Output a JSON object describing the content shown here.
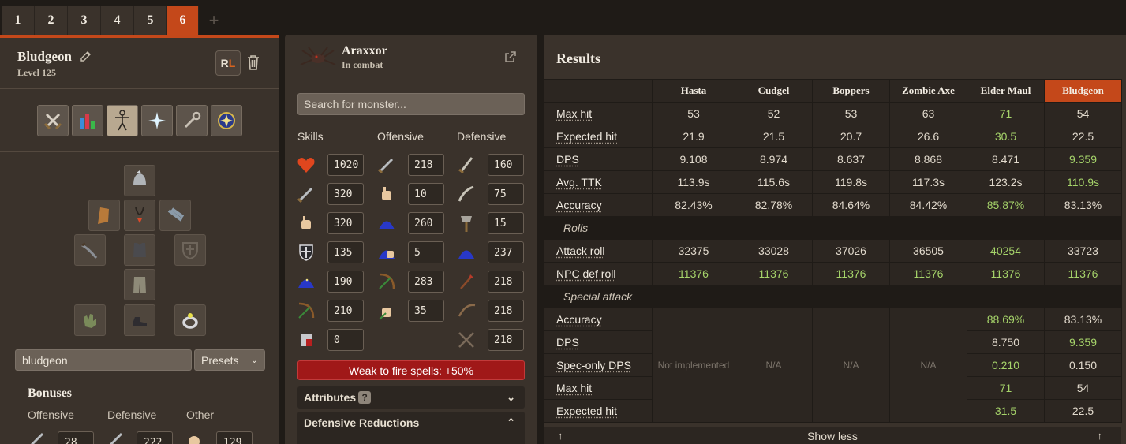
{
  "tabs": [
    "1",
    "2",
    "3",
    "4",
    "5",
    "6"
  ],
  "active_tab": "6",
  "loadout": {
    "name": "Bludgeon",
    "level": "Level 125",
    "rl_label_r": "R",
    "rl_label_l": "L",
    "search_value": "bludgeon",
    "presets_label": "Presets"
  },
  "bonuses": {
    "title": "Bonuses",
    "offensive_label": "Offensive",
    "defensive_label": "Defensive",
    "other_label": "Other",
    "values": [
      "28",
      "222",
      "129"
    ]
  },
  "monster": {
    "name": "Araxxor",
    "status": "In combat",
    "search_placeholder": "Search for monster...",
    "skills_label": "Skills",
    "offensive_label": "Offensive",
    "defensive_label": "Defensive",
    "skills": [
      "1020",
      "320",
      "320",
      "135",
      "190",
      "210",
      "0"
    ],
    "offensive": [
      "218",
      "10",
      "260",
      "5",
      "283",
      "35"
    ],
    "defensive": [
      "160",
      "75",
      "15",
      "237",
      "218",
      "218",
      "218"
    ],
    "weakness": "Weak to fire spells: +50%",
    "attributes_label": "Attributes",
    "attributes_help": "?",
    "def_reductions_label": "Defensive Reductions"
  },
  "results": {
    "title": "Results",
    "columns": [
      "Hasta",
      "Cudgel",
      "Boppers",
      "Zombie Axe",
      "Elder Maul",
      "Bludgeon"
    ],
    "rows": [
      {
        "label": "Max hit",
        "values": [
          "53",
          "52",
          "53",
          "63",
          "71",
          "54"
        ]
      },
      {
        "label": "Expected hit",
        "values": [
          "21.9",
          "21.5",
          "20.7",
          "26.6",
          "30.5",
          "22.5"
        ]
      },
      {
        "label": "DPS",
        "values": [
          "9.108",
          "8.974",
          "8.637",
          "8.868",
          "8.471",
          "9.359"
        ]
      },
      {
        "label": "Avg. TTK",
        "values": [
          "113.9s",
          "115.6s",
          "119.8s",
          "117.3s",
          "123.2s",
          "110.9s"
        ]
      },
      {
        "label": "Accuracy",
        "values": [
          "82.43%",
          "82.78%",
          "84.64%",
          "84.42%",
          "85.87%",
          "83.13%"
        ]
      }
    ],
    "rolls_label": "Rolls",
    "rolls": [
      {
        "label": "Attack roll",
        "values": [
          "32375",
          "33028",
          "37026",
          "36505",
          "40254",
          "33723"
        ]
      },
      {
        "label": "NPC def roll",
        "values": [
          "11376",
          "11376",
          "11376",
          "11376",
          "11376",
          "11376"
        ]
      }
    ],
    "special_label": "Special attack",
    "special_rows": [
      {
        "label": "Accuracy",
        "values": [
          "88.69%",
          "83.13%"
        ]
      },
      {
        "label": "DPS",
        "values": [
          "8.750",
          "9.359"
        ]
      },
      {
        "label": "Spec-only DPS",
        "values": [
          "0.210",
          "0.150"
        ]
      },
      {
        "label": "Max hit",
        "values": [
          "71",
          "54"
        ]
      },
      {
        "label": "Expected hit",
        "values": [
          "31.5",
          "22.5"
        ]
      }
    ],
    "not_implemented": "Not implemented",
    "na": "N/A",
    "show_less": "Show less",
    "best_color": "#a6d46a",
    "accent_color": "#c4481a"
  }
}
